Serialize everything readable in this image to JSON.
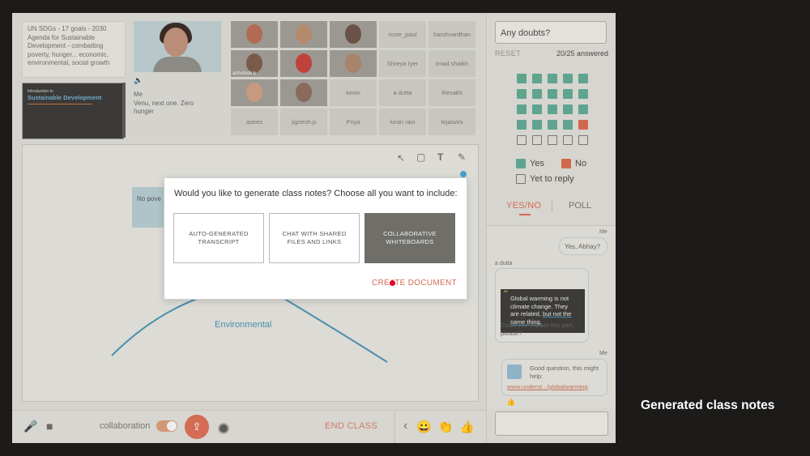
{
  "agenda": {
    "text": "UN SDGs - 17 goals - 2030 Agenda for Sustainable Development - combatting poverty, hunger... economic, environmental, social growth"
  },
  "slide": {
    "subtitle": "Introduction to",
    "title": "Sustainable Development"
  },
  "presenter": {
    "me_label": "Me",
    "me_message": "Venu, next one. Zero hunger",
    "speaker_icon": "speaker-icon"
  },
  "participants": [
    {
      "name": "",
      "photo": true,
      "face_color": "#b06b52"
    },
    {
      "name": "",
      "photo": true,
      "face_color": "#b48a6c"
    },
    {
      "name": "",
      "photo": true,
      "face_color": "#6a5346"
    },
    {
      "name": "rosie_paul",
      "photo": false
    },
    {
      "name": "harshvardhan",
      "photo": false
    },
    {
      "name": "ashutosh k",
      "photo": true,
      "face_color": "#7a5a4a"
    },
    {
      "name": "",
      "photo": true,
      "face_color": "#c0423c"
    },
    {
      "name": "",
      "photo": true,
      "face_color": "#a9836a"
    },
    {
      "name": "Shreya Iyer",
      "photo": false
    },
    {
      "name": "Imad shaikh",
      "photo": false
    },
    {
      "name": "",
      "photo": true,
      "face_color": "#c79a80"
    },
    {
      "name": "",
      "photo": true,
      "face_color": "#8a6a5a"
    },
    {
      "name": "kevin",
      "photo": false
    },
    {
      "name": "a dutta",
      "photo": false
    },
    {
      "name": "Revathi",
      "photo": false
    },
    {
      "name": "asees",
      "photo": false
    },
    {
      "name": "jignesh.p",
      "photo": false
    },
    {
      "name": "Priya",
      "photo": false
    },
    {
      "name": "kiran ravi",
      "photo": false
    },
    {
      "name": "tejasvini",
      "photo": false
    }
  ],
  "whiteboard": {
    "sticky_text": "No pove",
    "environmental_label": "Environmental",
    "tool_cursor": "↖",
    "tool_note": "▢",
    "tool_text": "T",
    "tool_pen": "✎"
  },
  "bottombar": {
    "mic_icon": "🎤",
    "camera_icon": "■",
    "collaboration_label": "collaboration",
    "end_class": "END CLASS",
    "back": "‹"
  },
  "emoji_bar": {
    "items": [
      "😀",
      "👏",
      "👍"
    ]
  },
  "right_panel": {
    "doubts_title": "Any doubts?",
    "reset": "RESET",
    "answered": "20/25 answered",
    "grid_colors": {
      "yes": "#5fa48f",
      "no": "#d0694c",
      "pending": "transparent"
    },
    "legend": {
      "yes": "Yes",
      "no": "No",
      "pending": "Yet to reply"
    },
    "tabs": {
      "yesno": "YES/NO",
      "poll": "POLL"
    }
  },
  "chat": {
    "me_label_1": "Me",
    "me_message_1": "Yes, Abhay?",
    "other_name": "a dutta",
    "quote_text_1": "Global warming is not climate change. They are related, ",
    "quote_text_2": "but not the same thing.",
    "quote_question": "Could you explain this part, please?",
    "me_label_2": "Me",
    "me_message_2": "Good question, this might help:",
    "me_link": "www.underst.../globalwarming",
    "reaction": "👍"
  },
  "modal": {
    "question": "Would you like to generate class notes? Choose all you want to include:",
    "options": [
      {
        "label": "AUTO-GENERATED TRANSCRIPT",
        "selected": false
      },
      {
        "label": "CHAT WITH SHARED FILES AND LINKS",
        "selected": false
      },
      {
        "label": "COLLABORATIVE WHITEBOARDS",
        "selected": true
      }
    ],
    "create_button": "CREATE DOCUMENT"
  },
  "caption": "Generated class notes",
  "colors": {
    "accent": "#d46b55",
    "chart_blue": "#4a8fae",
    "background": "#1c1b1a"
  }
}
